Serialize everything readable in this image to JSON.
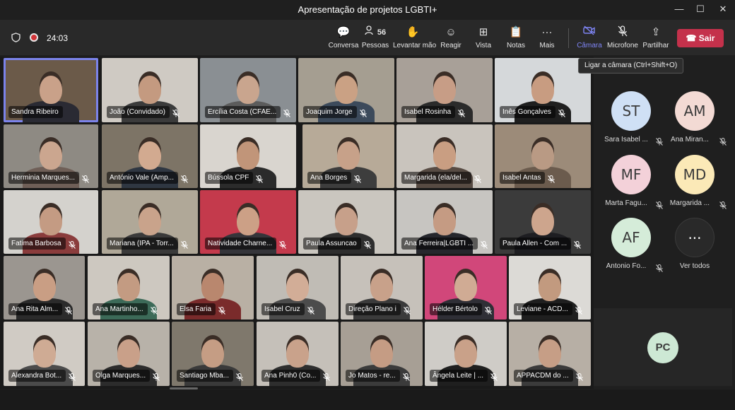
{
  "window": {
    "title": "Apresentação de projetos LGBTI+",
    "controls": {
      "minimize": "—",
      "maximize": "☐",
      "close": "✕"
    }
  },
  "toolbar": {
    "timer": "24:03",
    "people_count": "56",
    "buttons": [
      {
        "label": "Conversa",
        "icon": "chat-icon",
        "glyph": "💬"
      },
      {
        "label": "Pessoas",
        "icon": "people-icon",
        "glyph": ""
      },
      {
        "label": "Levantar mão",
        "icon": "raise-hand-icon",
        "glyph": "✋"
      },
      {
        "label": "Reagir",
        "icon": "react-icon",
        "glyph": "☺"
      },
      {
        "label": "Vista",
        "icon": "view-icon",
        "glyph": "⊞"
      },
      {
        "label": "Notas",
        "icon": "notes-icon",
        "glyph": "📋"
      },
      {
        "label": "Mais",
        "icon": "more-icon",
        "glyph": "···"
      },
      {
        "label": "Câmara",
        "icon": "camera-off-icon",
        "glyph": ""
      },
      {
        "label": "Microfone",
        "icon": "mic-off-icon",
        "glyph": ""
      },
      {
        "label": "Partilhar",
        "icon": "share-icon",
        "glyph": "⇪"
      }
    ],
    "leave_label": "Sair",
    "camera_tooltip": "Ligar a câmara (Ctrl+Shift+O)"
  },
  "colors": {
    "accent": "#7b83eb",
    "leave": "#c4314b",
    "background": "#1f1f1f"
  },
  "participants": [
    {
      "name": "Sandra Ribeiro",
      "muted": false,
      "speaking": true,
      "bg": "#6b5a49",
      "skin": "#c9a189",
      "shirt": "#2a2a33"
    },
    {
      "name": "João (Convidado)",
      "muted": true,
      "bg": "#cfcac3",
      "skin": "#c49a80",
      "shirt": "#3b3b3b"
    },
    {
      "name": "Ercília Costa (CFAE...",
      "muted": true,
      "bg": "#8a8f93",
      "skin": "#c9a58e",
      "shirt": "#5c5c5c"
    },
    {
      "name": "Joaquim Jorge",
      "muted": true,
      "bg": "#a59e91",
      "skin": "#caa184",
      "shirt": "#3c4a5b"
    },
    {
      "name": "Isabel Rosinha",
      "muted": true,
      "bg": "#a8a098",
      "skin": "#c79d86",
      "shirt": "#2b2b2b"
    },
    {
      "name": "Inês Gonçalves",
      "muted": true,
      "bg": "#d5d8da",
      "skin": "#c89c81",
      "shirt": "#1f1f1f"
    },
    {
      "name": "Herminia Marques...",
      "muted": true,
      "bg": "#8e8a83",
      "skin": "#cba68f",
      "shirt": "#6f5f57"
    },
    {
      "name": "António Vale (Amp...",
      "muted": true,
      "bg": "#7d7466",
      "skin": "#d2aa90",
      "shirt": "#2f3742"
    },
    {
      "name": "Bússola CPF",
      "muted": true,
      "bg": "#d9d5cf",
      "skin": "#c19579",
      "shirt": "#2b2b2b"
    },
    {
      "name": "Ana Borges",
      "muted": true,
      "bg": "#b7aa98",
      "skin": "#c7a189",
      "shirt": "#3d3d3d"
    },
    {
      "name": "Margarida (ela/del...",
      "muted": true,
      "bg": "#c9c4bd",
      "skin": "#c99e82",
      "shirt": "#574b43"
    },
    {
      "name": "Isabel Antas",
      "muted": true,
      "bg": "#9c8b79",
      "skin": "#b99a84",
      "shirt": "#6b5b4d"
    },
    {
      "name": "Fatima Barbosa",
      "muted": true,
      "bg": "#d4d2cd",
      "skin": "#c49b83",
      "shirt": "#8a3c3c"
    },
    {
      "name": "Mariana (IPA - Torr...",
      "muted": true,
      "bg": "#b0a898",
      "skin": "#c9a38b",
      "shirt": "#3a3a3a"
    },
    {
      "name": "Natividade Charne...",
      "muted": true,
      "bg": "#c43a4c",
      "skin": "#cca086",
      "shirt": "#35353a"
    },
    {
      "name": "Paula Assuncao",
      "muted": true,
      "bg": "#cac6bf",
      "skin": "#c7a08a",
      "shirt": "#2e2e2e"
    },
    {
      "name": "Ana Ferreira|LGBTI ...",
      "muted": true,
      "bg": "#c7c5c1",
      "skin": "#c59b83",
      "shirt": "#26272d"
    },
    {
      "name": "Paula Allen - Com ...",
      "muted": true,
      "bg": "#3b3b3b",
      "skin": "#cda58d",
      "shirt": "#1e1e22"
    },
    {
      "name": "Ana Rita Alm...",
      "muted": true,
      "bg": "#9b9690",
      "skin": "#c99e84",
      "shirt": "#2b2b2b"
    },
    {
      "name": "Ana Martinho...",
      "muted": true,
      "bg": "#cdc8c0",
      "skin": "#c39b82",
      "shirt": "#3c6a58"
    },
    {
      "name": "Elsa Faria",
      "muted": true,
      "bg": "#b9b0a4",
      "skin": "#b9876e",
      "shirt": "#7a2b2b"
    },
    {
      "name": "Isabel Cruz",
      "muted": true,
      "bg": "#c0bcb5",
      "skin": "#d2ad97",
      "shirt": "#4c4c4c"
    },
    {
      "name": "Direção Plano i",
      "muted": true,
      "bg": "#c6c1ba",
      "skin": "#c8a18a",
      "shirt": "#3b3b3b"
    },
    {
      "name": "Hélder Bértolo",
      "muted": true,
      "bg": "#d1477a",
      "skin": "#d0ab94",
      "shirt": "#2f2f36"
    },
    {
      "name": "Leviane - ACD...",
      "muted": true,
      "bg": "#dcdad6",
      "skin": "#c29a7f",
      "shirt": "#1f1f1f"
    },
    {
      "name": "Alexandra Bot...",
      "muted": true,
      "bg": "#d0cbc4",
      "skin": "#cfab94",
      "shirt": "#4b4b4b"
    },
    {
      "name": "Olga Marques...",
      "muted": true,
      "bg": "#b8b2a9",
      "skin": "#c9a089",
      "shirt": "#2c2c2c"
    },
    {
      "name": "Santiago Mba...",
      "muted": true,
      "bg": "#7f786c",
      "skin": "#c59d84",
      "shirt": "#3a3a3a"
    },
    {
      "name": "Ana Pinh0 (Co...",
      "muted": true,
      "bg": "#c5c0b9",
      "skin": "#c9a28b",
      "shirt": "#2e2e2e"
    },
    {
      "name": "Jo Matos - re...",
      "muted": true,
      "bg": "#a79f95",
      "skin": "#c59c84",
      "shirt": "#3b3b3b"
    },
    {
      "name": "Ângela Leite | ...",
      "muted": true,
      "bg": "#cfccc7",
      "skin": "#c9a189",
      "shirt": "#1f1f1f"
    },
    {
      "name": "APPACDM do ...",
      "muted": true,
      "bg": "#b7afa5",
      "skin": "#c69e86",
      "shirt": "#3b3b3b"
    }
  ],
  "side_avatars": [
    {
      "initials": "ST",
      "name": "Sara Isabel ...",
      "color": "#cfe0f5"
    },
    {
      "initials": "AM",
      "name": "Ana Miran...",
      "color": "#f3dad4"
    },
    {
      "initials": "MF",
      "name": "Marta Fagu...",
      "color": "#f3d1d9"
    },
    {
      "initials": "MD",
      "name": "Margarida ...",
      "color": "#fbe9b7"
    },
    {
      "initials": "AF",
      "name": "Antonio Fo...",
      "color": "#d5ecd9"
    },
    {
      "initials": "···",
      "name": "Ver todos",
      "color": "#292929"
    }
  ],
  "self_view": {
    "initials": "PC"
  }
}
